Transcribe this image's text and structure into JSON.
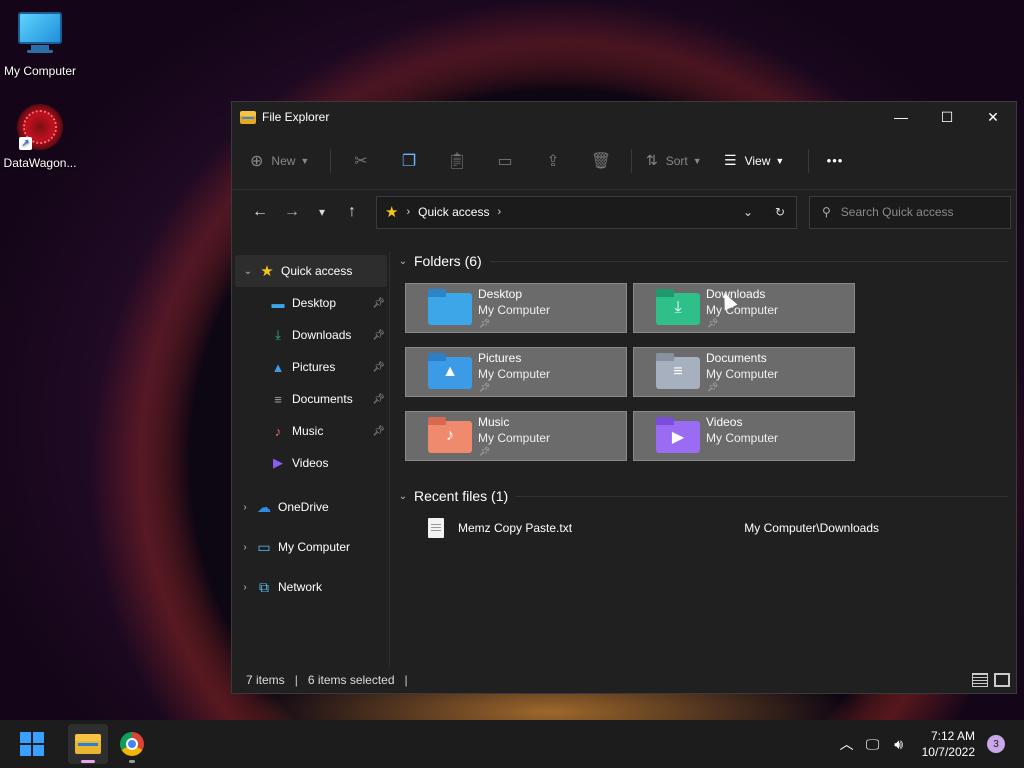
{
  "desktop": {
    "icons": [
      {
        "label": "My Computer",
        "icon": "monitor-icon"
      },
      {
        "label": "DataWagon...",
        "icon": "datawagon-icon"
      }
    ]
  },
  "window": {
    "title": "File Explorer",
    "controls": {
      "minimize": "—",
      "maximize": "☐",
      "close": "✕"
    }
  },
  "toolbar": {
    "new_label": "New",
    "sort_label": "Sort",
    "view_label": "View",
    "more_label": "•••"
  },
  "nav": {
    "back": "←",
    "forward": "→",
    "recent": "⌄",
    "up": "↑",
    "address_root": "Quick access",
    "search_placeholder": "Search Quick access"
  },
  "sidebar": {
    "quick_access": "Quick access",
    "pinned": [
      {
        "label": "Desktop",
        "icon": "desktop-icon",
        "color": "#3ba7e8",
        "pinned": true
      },
      {
        "label": "Downloads",
        "icon": "download-icon",
        "color": "#2fb67a",
        "pinned": true
      },
      {
        "label": "Pictures",
        "icon": "pictures-icon",
        "color": "#3c9be6",
        "pinned": true
      },
      {
        "label": "Documents",
        "icon": "documents-icon",
        "color": "#9aa3b0",
        "pinned": true
      },
      {
        "label": "Music",
        "icon": "music-icon",
        "color": "#e8705a",
        "pinned": true
      },
      {
        "label": "Videos",
        "icon": "videos-icon",
        "color": "#8b5cf0",
        "pinned": false
      }
    ],
    "roots": [
      {
        "label": "OneDrive",
        "icon": "cloud-icon"
      },
      {
        "label": "My Computer",
        "icon": "computer-icon"
      },
      {
        "label": "Network",
        "icon": "network-icon"
      }
    ]
  },
  "main": {
    "folders_header": "Folders (6)",
    "folders": [
      {
        "name": "Desktop",
        "location": "My Computer",
        "pinned": true,
        "color": "#3ba7e8",
        "tab": "#2a86c8",
        "symbol": ""
      },
      {
        "name": "Downloads",
        "location": "My Computer",
        "pinned": true,
        "color": "#2fc08a",
        "tab": "#1f9a6a",
        "symbol": "⤓"
      },
      {
        "name": "Pictures",
        "location": "My Computer",
        "pinned": true,
        "color": "#3c9be6",
        "tab": "#2a7fc7",
        "symbol": "▲"
      },
      {
        "name": "Documents",
        "location": "My Computer",
        "pinned": true,
        "color": "#a7b0bf",
        "tab": "#8891a0",
        "symbol": "≡"
      },
      {
        "name": "Music",
        "location": "My Computer",
        "pinned": true,
        "color": "#f08a6c",
        "tab": "#d86850",
        "symbol": "♪"
      },
      {
        "name": "Videos",
        "location": "My Computer",
        "pinned": false,
        "color": "#9a6cf4",
        "tab": "#7a4ed8",
        "symbol": "▶"
      }
    ],
    "recent_header": "Recent files (1)",
    "recent": [
      {
        "name": "Memz Copy Paste.txt",
        "location": "My Computer\\Downloads"
      }
    ]
  },
  "status": {
    "items": "7 items",
    "selected": "6 items selected"
  },
  "taskbar": {
    "time": "7:12 AM",
    "date": "10/7/2022",
    "notifications": "3"
  }
}
